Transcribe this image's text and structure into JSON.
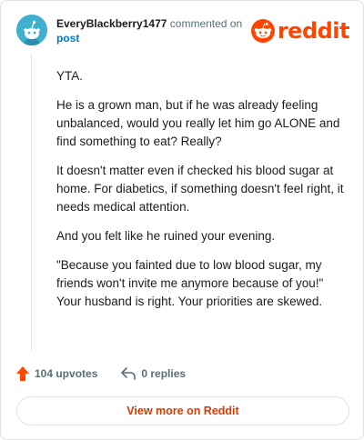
{
  "comment": {
    "author": "EveryBlackberry1477",
    "action_text": "commented on",
    "post_link": "post",
    "paragraphs": [
      "YTA.",
      "He is a grown man, but if he was already feeling unbalanced, would you really let him go ALONE and find something to eat? Really?",
      "It doesn't matter even if checked his blood sugar at home. For diabetics, if something doesn't feel right, it needs medical attention.",
      "And you felt like he ruined your evening.",
      "\"Because you fainted due to low blood sugar, my friends won't invite me anymore because of you!\" Your husband is right. Your priorities are skewed."
    ],
    "upvotes": "104 upvotes",
    "replies": "0 replies"
  },
  "brand": {
    "wordmark": "reddit",
    "color": "#ff4500",
    "logo_icon": "reddit-snoo-icon"
  },
  "footer": {
    "view_label": "View more on Reddit"
  },
  "colors": {
    "upvote": "#ff4500",
    "link": "#0079d3",
    "muted": "#576f76",
    "button_text": "#d93a00",
    "avatar_bg": "#3fb1cf"
  },
  "icons": {
    "avatar": "snoo-avatar-icon",
    "upvote": "upvote-arrow-icon",
    "reply": "reply-arrow-icon"
  }
}
